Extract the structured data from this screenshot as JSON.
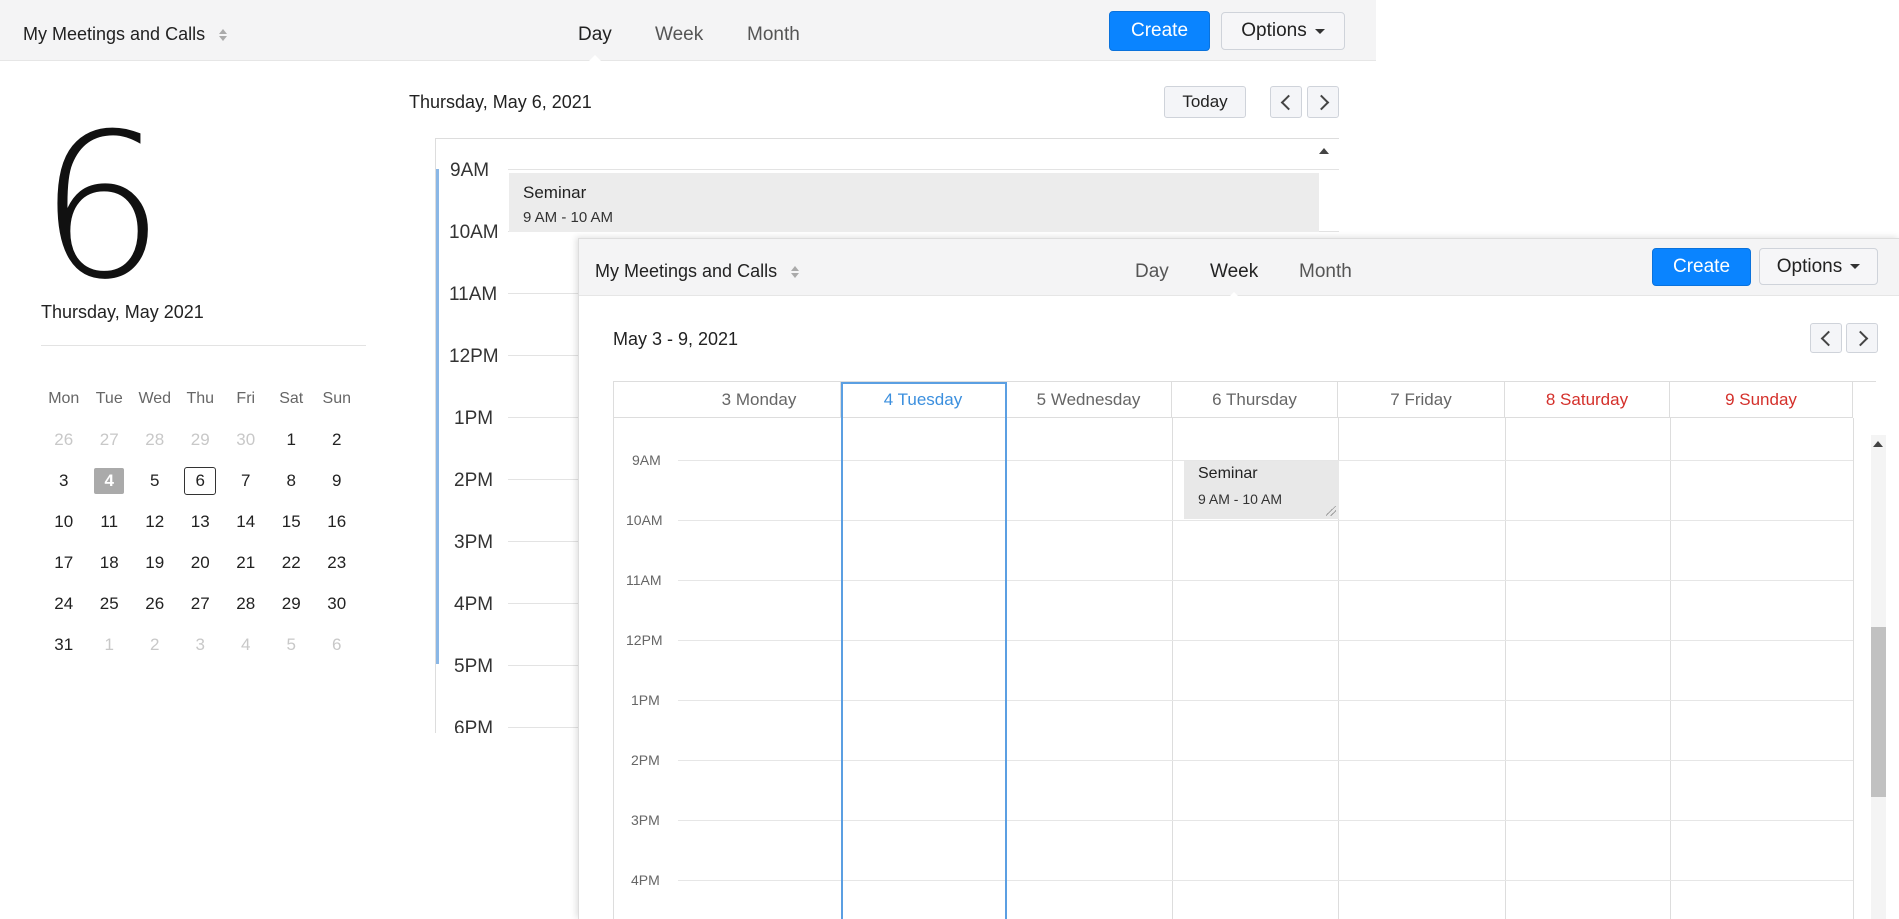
{
  "colors": {
    "accent": "#0a84ff",
    "weekend": "#d4302b",
    "current_day": "#3b8fde",
    "event_bg": "#ececec"
  },
  "day_window": {
    "calendar_selector": "My Meetings and Calls",
    "tabs": [
      "Day",
      "Week",
      "Month"
    ],
    "active_tab": "Day",
    "create_label": "Create",
    "options_label": "Options",
    "big_day_number": "6",
    "big_date_label": "Thursday, May 2021",
    "mini_calendar": {
      "weekdays": [
        "Mon",
        "Tue",
        "Wed",
        "Thu",
        "Fri",
        "Sat",
        "Sun"
      ],
      "weeks": [
        [
          "26",
          "27",
          "28",
          "29",
          "30",
          "1",
          "2"
        ],
        [
          "3",
          "4",
          "5",
          "6",
          "7",
          "8",
          "9"
        ],
        [
          "10",
          "11",
          "12",
          "13",
          "14",
          "15",
          "16"
        ],
        [
          "17",
          "18",
          "19",
          "20",
          "21",
          "22",
          "23"
        ],
        [
          "24",
          "25",
          "26",
          "27",
          "28",
          "29",
          "30"
        ],
        [
          "31",
          "1",
          "2",
          "3",
          "4",
          "5",
          "6"
        ]
      ],
      "selected": "4",
      "today": "6"
    },
    "date_heading": "Thursday, May 6, 2021",
    "today_label": "Today",
    "hours": [
      "9AM",
      "10AM",
      "11AM",
      "12PM",
      "1PM",
      "2PM",
      "3PM",
      "4PM",
      "5PM",
      "6PM"
    ],
    "event": {
      "title": "Seminar",
      "time": "9 AM - 10 AM"
    }
  },
  "week_window": {
    "calendar_selector": "My Meetings and Calls",
    "tabs": [
      "Day",
      "Week",
      "Month"
    ],
    "active_tab": "Week",
    "create_label": "Create",
    "options_label": "Options",
    "range_heading": "May 3 - 9, 2021",
    "days": [
      "3 Monday",
      "4 Tuesday",
      "5 Wednesday",
      "6 Thursday",
      "7 Friday",
      "8 Saturday",
      "9 Sunday"
    ],
    "hours": [
      "9AM",
      "10AM",
      "11AM",
      "12PM",
      "1PM",
      "2PM",
      "3PM",
      "4PM"
    ],
    "event": {
      "title": "Seminar",
      "time": "9 AM - 10 AM",
      "day": "6 Thursday"
    }
  }
}
